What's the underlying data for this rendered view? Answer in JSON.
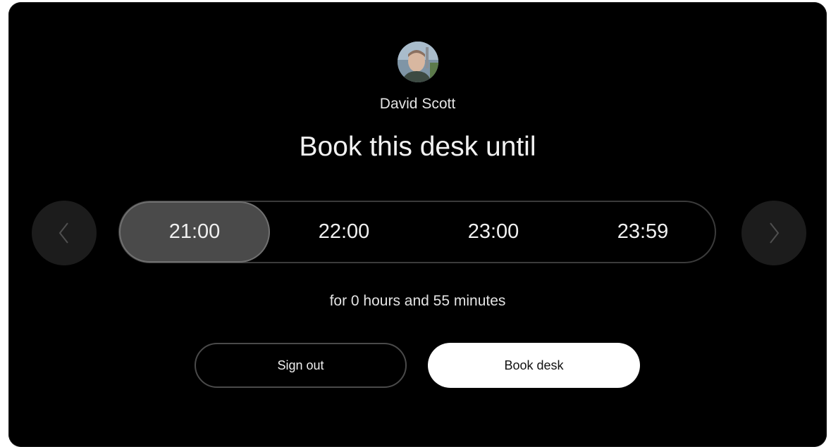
{
  "user": {
    "name": "David Scott"
  },
  "headline": "Book this desk until",
  "time_options": [
    {
      "label": "21:00",
      "selected": true
    },
    {
      "label": "22:00",
      "selected": false
    },
    {
      "label": "23:00",
      "selected": false
    },
    {
      "label": "23:59",
      "selected": false
    }
  ],
  "duration_text": "for 0 hours and 55 minutes",
  "actions": {
    "sign_out_label": "Sign out",
    "book_label": "Book desk"
  },
  "icons": {
    "prev": "chevron-left-icon",
    "next": "chevron-right-icon"
  },
  "colors": {
    "background": "#000000",
    "selected_pill": "#4a4a4a",
    "primary_button": "#ffffff"
  }
}
